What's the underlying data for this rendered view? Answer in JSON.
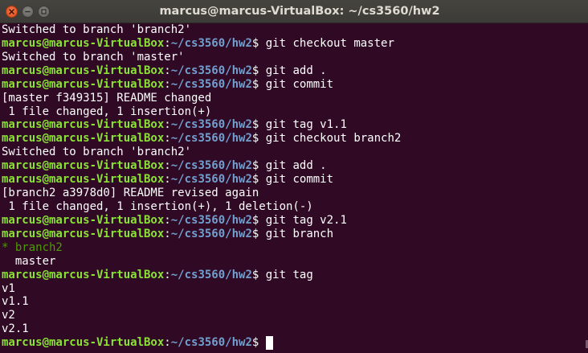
{
  "window": {
    "title": "marcus@marcus-VirtualBox: ~/cs3560/hw2"
  },
  "prompt": {
    "user": "marcus@marcus-VirtualBox",
    "colon": ":",
    "path": "~/cs3560/hw2",
    "dollar": "$ "
  },
  "colors": {
    "background": "#300a24",
    "prompt_user": "#8ae234",
    "prompt_path": "#729fcf",
    "current_branch": "#4e9a06",
    "close_button": "#df4a16"
  },
  "lines": [
    {
      "kind": "out",
      "text": "Switched to branch 'branch2'"
    },
    {
      "kind": "cmd",
      "text": "git checkout master"
    },
    {
      "kind": "out",
      "text": "Switched to branch 'master'"
    },
    {
      "kind": "cmd",
      "text": "git add ."
    },
    {
      "kind": "cmd",
      "text": "git commit"
    },
    {
      "kind": "out",
      "text": "[master f349315] README changed"
    },
    {
      "kind": "out",
      "text": " 1 file changed, 1 insertion(+)"
    },
    {
      "kind": "cmd",
      "text": "git tag v1.1"
    },
    {
      "kind": "cmd",
      "text": "git checkout branch2"
    },
    {
      "kind": "out",
      "text": "Switched to branch 'branch2'"
    },
    {
      "kind": "cmd",
      "text": "git add ."
    },
    {
      "kind": "cmd",
      "text": "git commit"
    },
    {
      "kind": "out",
      "text": "[branch2 a3978d0] README revised again"
    },
    {
      "kind": "out",
      "text": " 1 file changed, 1 insertion(+), 1 deletion(-)"
    },
    {
      "kind": "cmd",
      "text": "git tag v2.1"
    },
    {
      "kind": "cmd",
      "text": "git branch"
    },
    {
      "kind": "current-branch",
      "text": "* branch2"
    },
    {
      "kind": "out",
      "text": "  master"
    },
    {
      "kind": "cmd",
      "text": "git tag"
    },
    {
      "kind": "out",
      "text": "v1"
    },
    {
      "kind": "out",
      "text": "v1.1"
    },
    {
      "kind": "out",
      "text": "v2"
    },
    {
      "kind": "out",
      "text": "v2.1"
    },
    {
      "kind": "prompt-empty",
      "text": ""
    }
  ]
}
